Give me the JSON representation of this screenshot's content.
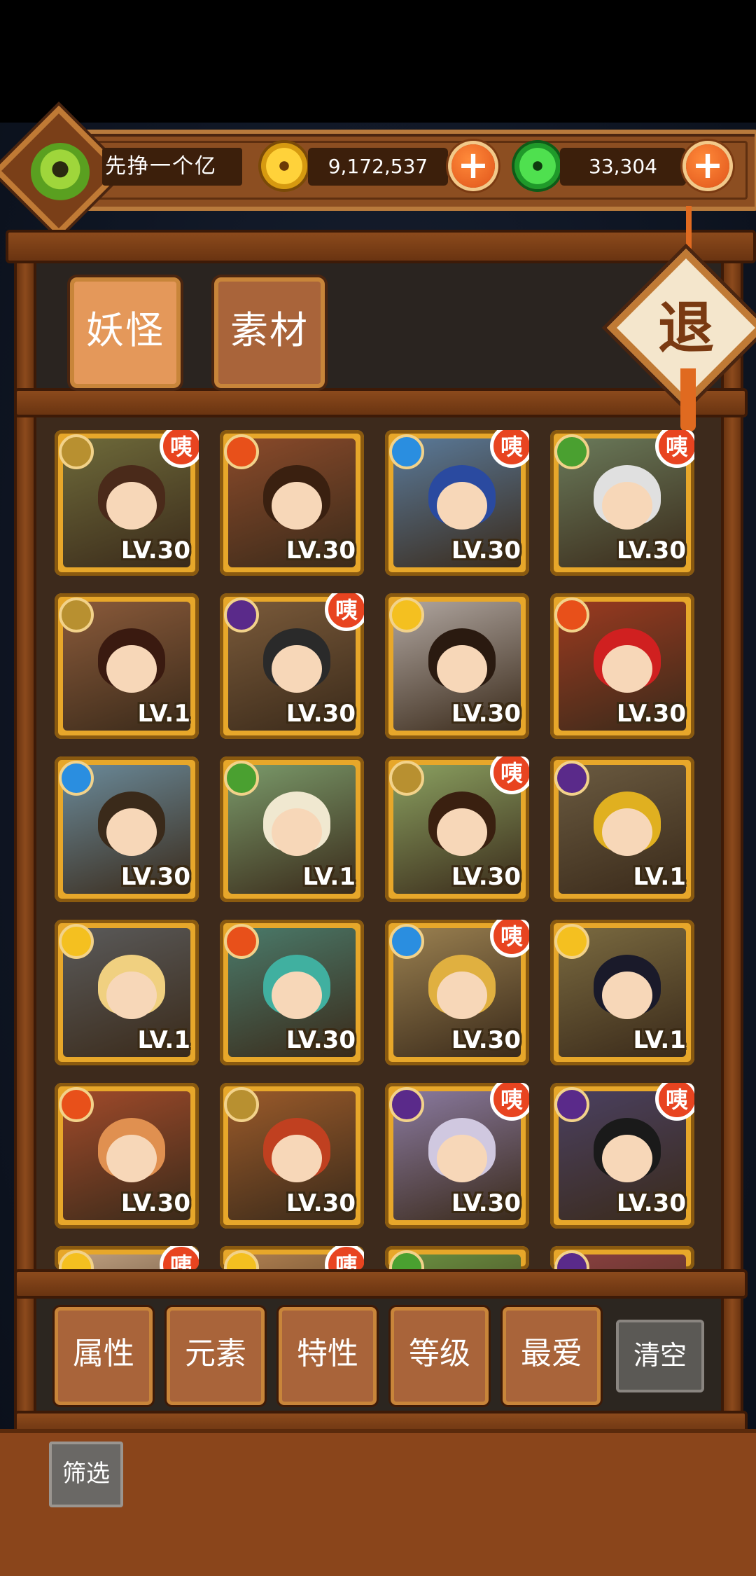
{
  "player": {
    "name": "先挣一个亿",
    "avatar_icon": "jade-coin-icon"
  },
  "currency": {
    "gold": {
      "value": "9,172,537",
      "icon": "gold-coin-icon",
      "add_label": "+"
    },
    "jade": {
      "value": "33,304",
      "icon": "jade-coin-icon",
      "add_label": "+"
    }
  },
  "tabs": [
    {
      "label": "妖怪",
      "selected": true
    },
    {
      "label": "素材",
      "selected": false
    }
  ],
  "retreat_label": "退",
  "badge_text": "咦",
  "element_colors": {
    "earth": "#b89030",
    "fire": "#e8501a",
    "water": "#2a8ee0",
    "wood": "#4aa030",
    "dark": "#5a2a8a",
    "light": "#f4c020"
  },
  "cards": [
    {
      "element": "earth",
      "level": "LV.30",
      "badge": true
    },
    {
      "element": "fire",
      "level": "LV.30",
      "badge": false
    },
    {
      "element": "water",
      "level": "LV.30",
      "badge": true
    },
    {
      "element": "wood",
      "level": "LV.30",
      "badge": true
    },
    {
      "element": "earth",
      "level": "LV.1",
      "badge": false
    },
    {
      "element": "dark",
      "level": "LV.30",
      "badge": true
    },
    {
      "element": "light",
      "level": "LV.30",
      "badge": false
    },
    {
      "element": "fire",
      "level": "LV.30",
      "badge": false
    },
    {
      "element": "water",
      "level": "LV.30",
      "badge": false
    },
    {
      "element": "wood",
      "level": "LV.1",
      "badge": false
    },
    {
      "element": "earth",
      "level": "LV.30",
      "badge": true
    },
    {
      "element": "dark",
      "level": "LV.1",
      "badge": false
    },
    {
      "element": "light",
      "level": "LV.1",
      "badge": false
    },
    {
      "element": "fire",
      "level": "LV.30",
      "badge": false
    },
    {
      "element": "water",
      "level": "LV.30",
      "badge": true
    },
    {
      "element": "light",
      "level": "LV.1",
      "badge": false
    },
    {
      "element": "fire",
      "level": "LV.30",
      "badge": false
    },
    {
      "element": "earth",
      "level": "LV.30",
      "badge": false
    },
    {
      "element": "dark",
      "level": "LV.30",
      "badge": true
    },
    {
      "element": "dark",
      "level": "LV.30",
      "badge": true
    },
    {
      "element": "light",
      "level": "",
      "badge": true
    },
    {
      "element": "light",
      "level": "",
      "badge": true
    },
    {
      "element": "wood",
      "level": "",
      "badge": false
    },
    {
      "element": "dark",
      "level": "",
      "badge": false
    }
  ],
  "filters": [
    "属性",
    "元素",
    "特性",
    "等级",
    "最爱"
  ],
  "clear_label": "清空",
  "sift_label": "筛选"
}
